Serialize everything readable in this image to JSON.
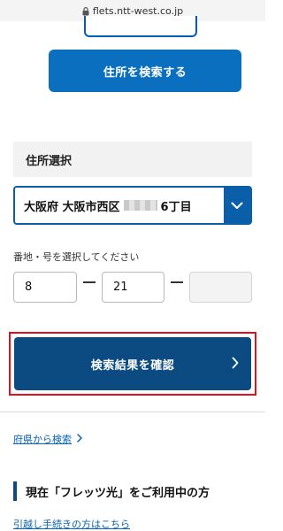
{
  "browser": {
    "url": "flets.ntt-west.co.jp"
  },
  "search_address_button": {
    "label": "住所を検索する"
  },
  "address_section": {
    "title": "住所選択",
    "selected_prefix": "大阪府 大阪市西区",
    "selected_suffix": "6丁目"
  },
  "lot_number": {
    "hint": "番地・号を選択してください",
    "field1": "8",
    "field2": "21",
    "field3": ""
  },
  "confirm_button": {
    "label": "検索結果を確認"
  },
  "links": {
    "search_from_prefecture": "府県から検索",
    "moving_procedure": "引越し手続きの方はこちら"
  },
  "current_users": {
    "title": "現在「フレッツ光」をご利用中の方"
  },
  "colors": {
    "primary": "#0a6fbf",
    "dark_primary": "#0b4b82",
    "highlight": "#e0101f"
  }
}
